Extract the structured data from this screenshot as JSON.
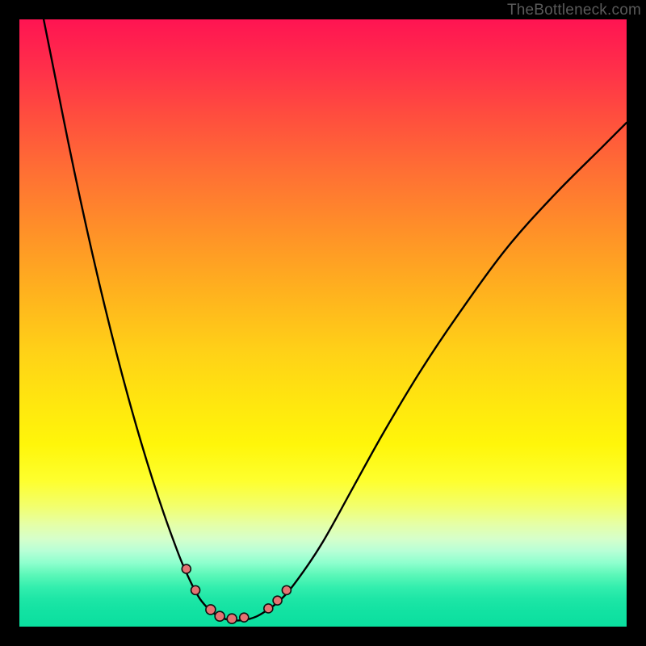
{
  "watermark": "TheBottleneck.com",
  "chart_data": {
    "type": "line",
    "title": "",
    "xlabel": "",
    "ylabel": "",
    "xlim": [
      0,
      100
    ],
    "ylim": [
      0,
      100
    ],
    "grid": false,
    "legend": false,
    "series": [
      {
        "name": "curve",
        "x": [
          4,
          6,
          8,
          10,
          12,
          14,
          16,
          18,
          20,
          22,
          24,
          26,
          27,
          28,
          29,
          30,
          31.5,
          33,
          34.5,
          36,
          38,
          40,
          43,
          46,
          50,
          55,
          60,
          66,
          72,
          80,
          88,
          96,
          100
        ],
        "values": [
          100,
          90,
          80,
          70.5,
          61.5,
          53,
          45,
          37.5,
          30.5,
          24,
          18,
          12.5,
          10,
          7.8,
          5.8,
          4.2,
          2.6,
          1.6,
          1.1,
          1.0,
          1.3,
          2.2,
          4.4,
          8,
          14,
          23,
          32,
          42,
          51,
          62,
          71,
          79,
          83
        ]
      }
    ],
    "markers": [
      {
        "x": 27.5,
        "y": 9.5,
        "r": 5.5
      },
      {
        "x": 29.0,
        "y": 6.0,
        "r": 5.5
      },
      {
        "x": 31.5,
        "y": 2.8,
        "r": 6.0
      },
      {
        "x": 33.0,
        "y": 1.7,
        "r": 6.0
      },
      {
        "x": 35.0,
        "y": 1.3,
        "r": 6.0
      },
      {
        "x": 37.0,
        "y": 1.5,
        "r": 5.5
      },
      {
        "x": 41.0,
        "y": 3.0,
        "r": 5.5
      },
      {
        "x": 42.5,
        "y": 4.3,
        "r": 5.5
      },
      {
        "x": 44.0,
        "y": 6.0,
        "r": 5.5
      }
    ],
    "marker_color": "#e57373",
    "marker_stroke": "#111111",
    "background_gradient": {
      "top": "#ff1452",
      "mid": "#ffe60f",
      "bottom": "#0adf9f"
    }
  }
}
